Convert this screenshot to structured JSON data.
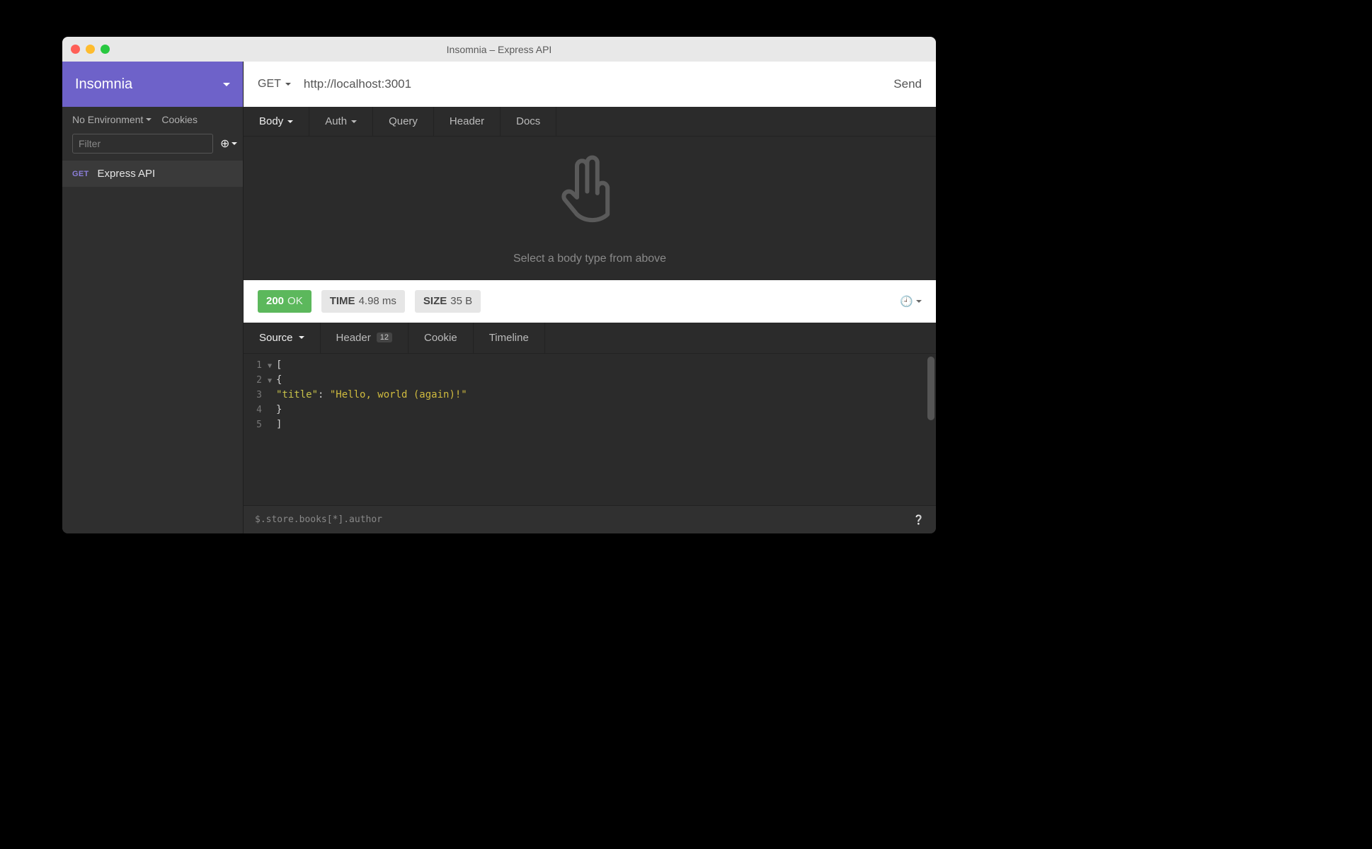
{
  "window": {
    "title": "Insomnia – Express API"
  },
  "sidebar": {
    "app_name": "Insomnia",
    "environment_label": "No Environment",
    "cookies_label": "Cookies",
    "filter_placeholder": "Filter",
    "requests": [
      {
        "method": "GET",
        "name": "Express API"
      }
    ]
  },
  "urlbar": {
    "method": "GET",
    "url": "http://localhost:3001",
    "send_label": "Send"
  },
  "request_tabs": {
    "body": "Body",
    "auth": "Auth",
    "query": "Query",
    "header": "Header",
    "docs": "Docs",
    "empty_message": "Select a body type from above"
  },
  "response_status": {
    "code": "200",
    "text": "OK",
    "time_label": "TIME",
    "time_value": "4.98 ms",
    "size_label": "SIZE",
    "size_value": "35 B"
  },
  "response_tabs": {
    "source": "Source",
    "header": "Header",
    "header_count": "12",
    "cookie": "Cookie",
    "timeline": "Timeline"
  },
  "response_body": {
    "lines": [
      {
        "n": "1",
        "fold": true,
        "content": [
          {
            "t": "tok",
            "v": "["
          }
        ]
      },
      {
        "n": "2",
        "fold": true,
        "content": [
          {
            "t": "tok",
            "v": "  {"
          }
        ]
      },
      {
        "n": "3",
        "fold": false,
        "content": [
          {
            "t": "tok",
            "v": "    "
          },
          {
            "t": "key",
            "v": "\"title\""
          },
          {
            "t": "tok",
            "v": ": "
          },
          {
            "t": "str",
            "v": "\"Hello, world (again)!\""
          }
        ]
      },
      {
        "n": "4",
        "fold": false,
        "content": [
          {
            "t": "tok",
            "v": "  }"
          }
        ]
      },
      {
        "n": "5",
        "fold": false,
        "content": [
          {
            "t": "tok",
            "v": "]"
          }
        ]
      }
    ]
  },
  "footer": {
    "jsonpath_placeholder": "$.store.books[*].author"
  }
}
